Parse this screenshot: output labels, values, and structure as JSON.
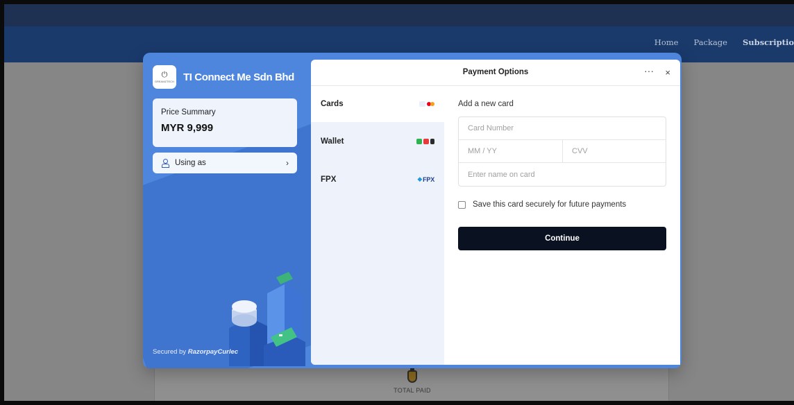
{
  "background": {
    "nav_links": [
      "Home",
      "Package",
      "Subscriptio"
    ],
    "total_paid_label": "TOTAL PAID"
  },
  "merchant": {
    "logo_text": "DREAMZTECH",
    "name": "TI Connect Me Sdn Bhd"
  },
  "summary": {
    "title": "Price Summary",
    "amount": "MYR 9,999"
  },
  "using_as": {
    "label": "Using as"
  },
  "secured": {
    "prefix": "Secured by",
    "brand": "RazorpayCurlec"
  },
  "modal": {
    "title": "Payment Options",
    "more_label": "···",
    "close_label": "×"
  },
  "methods": [
    {
      "label": "Cards",
      "icons": [
        "visa",
        "mastercard"
      ]
    },
    {
      "label": "Wallet",
      "icons": [
        "tng",
        "boost",
        "grab"
      ]
    },
    {
      "label": "FPX",
      "icons": [
        "fpx"
      ],
      "icon_text": "FPX"
    }
  ],
  "card_form": {
    "heading": "Add a new card",
    "card_number_placeholder": "Card Number",
    "expiry_placeholder": "MM / YY",
    "cvv_placeholder": "CVV",
    "name_placeholder": "Enter name on card",
    "save_label": "Save this card securely for future payments",
    "continue_label": "Continue"
  },
  "colors": {
    "modal_blue": "#4f86dd",
    "nav_blue": "#1a3a6c",
    "button_dark": "#0a1222"
  }
}
